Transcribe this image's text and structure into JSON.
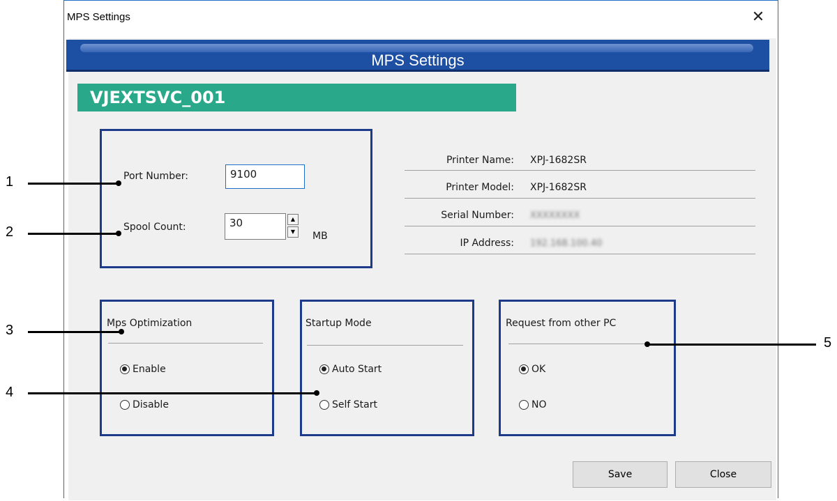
{
  "window": {
    "title": "MPS Settings",
    "close_symbol": "✕"
  },
  "header": {
    "title": "MPS Settings"
  },
  "device_name": "VJEXTSVC_001",
  "port": {
    "label": "Port Number:",
    "value": "9100"
  },
  "spool": {
    "label": "Spool Count:",
    "value": "30",
    "unit": "MB",
    "up": "▲",
    "down": "▼"
  },
  "info": [
    {
      "label": "Printer Name:",
      "value": "XPJ-1682SR"
    },
    {
      "label": "Printer Model:",
      "value": "XPJ-1682SR"
    },
    {
      "label": "Serial Number:",
      "value": "XXXXXXXX"
    },
    {
      "label": "IP Address:",
      "value": "192.168.100.40"
    }
  ],
  "groups": {
    "optimization": {
      "title": "Mps Optimization",
      "options": [
        "Enable",
        "Disable"
      ],
      "selected": "Enable"
    },
    "startup": {
      "title": "Startup Mode",
      "options": [
        "Auto Start",
        "Self Start"
      ],
      "selected": "Auto Start"
    },
    "request": {
      "title": "Request from other PC",
      "options": [
        "OK",
        "NO"
      ],
      "selected": "OK"
    }
  },
  "buttons": {
    "save": "Save",
    "close": "Close"
  },
  "callouts": [
    "1",
    "2",
    "3",
    "4",
    "5"
  ]
}
